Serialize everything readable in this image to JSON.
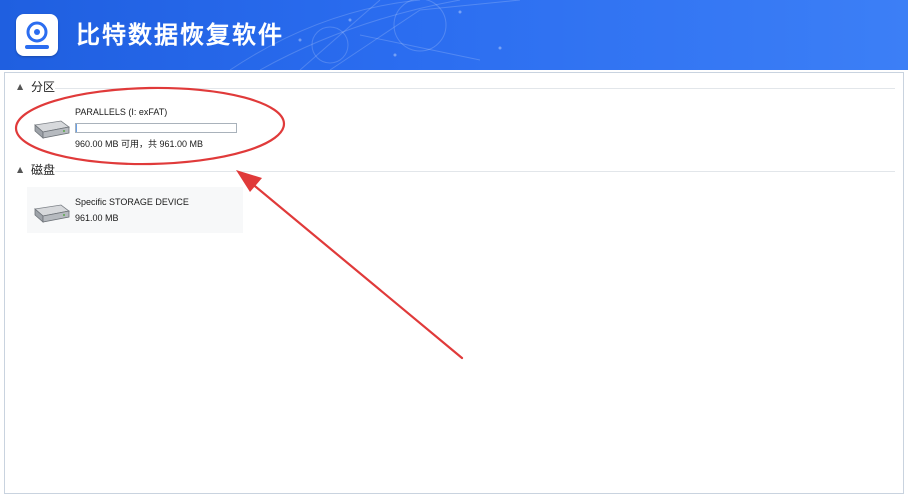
{
  "app": {
    "title": "比特数据恢复软件"
  },
  "colors": {
    "titlebar": "#2b6df0",
    "annotation": "#e03a3a"
  },
  "sections": [
    {
      "title": "分区",
      "collapse_icon": "triangle-down-icon"
    },
    {
      "title": "磁盘",
      "collapse_icon": "triangle-down-icon"
    }
  ],
  "partition": {
    "name": "PARALLELS (I: exFAT)",
    "usage_fraction": 0.001,
    "size_text": "960.00 MB 可用，共 961.00 MB",
    "icon": "hard-drive-icon"
  },
  "disk": {
    "name": "Specific STORAGE DEVICE",
    "size_text": "961.00 MB",
    "icon": "hard-drive-icon"
  }
}
